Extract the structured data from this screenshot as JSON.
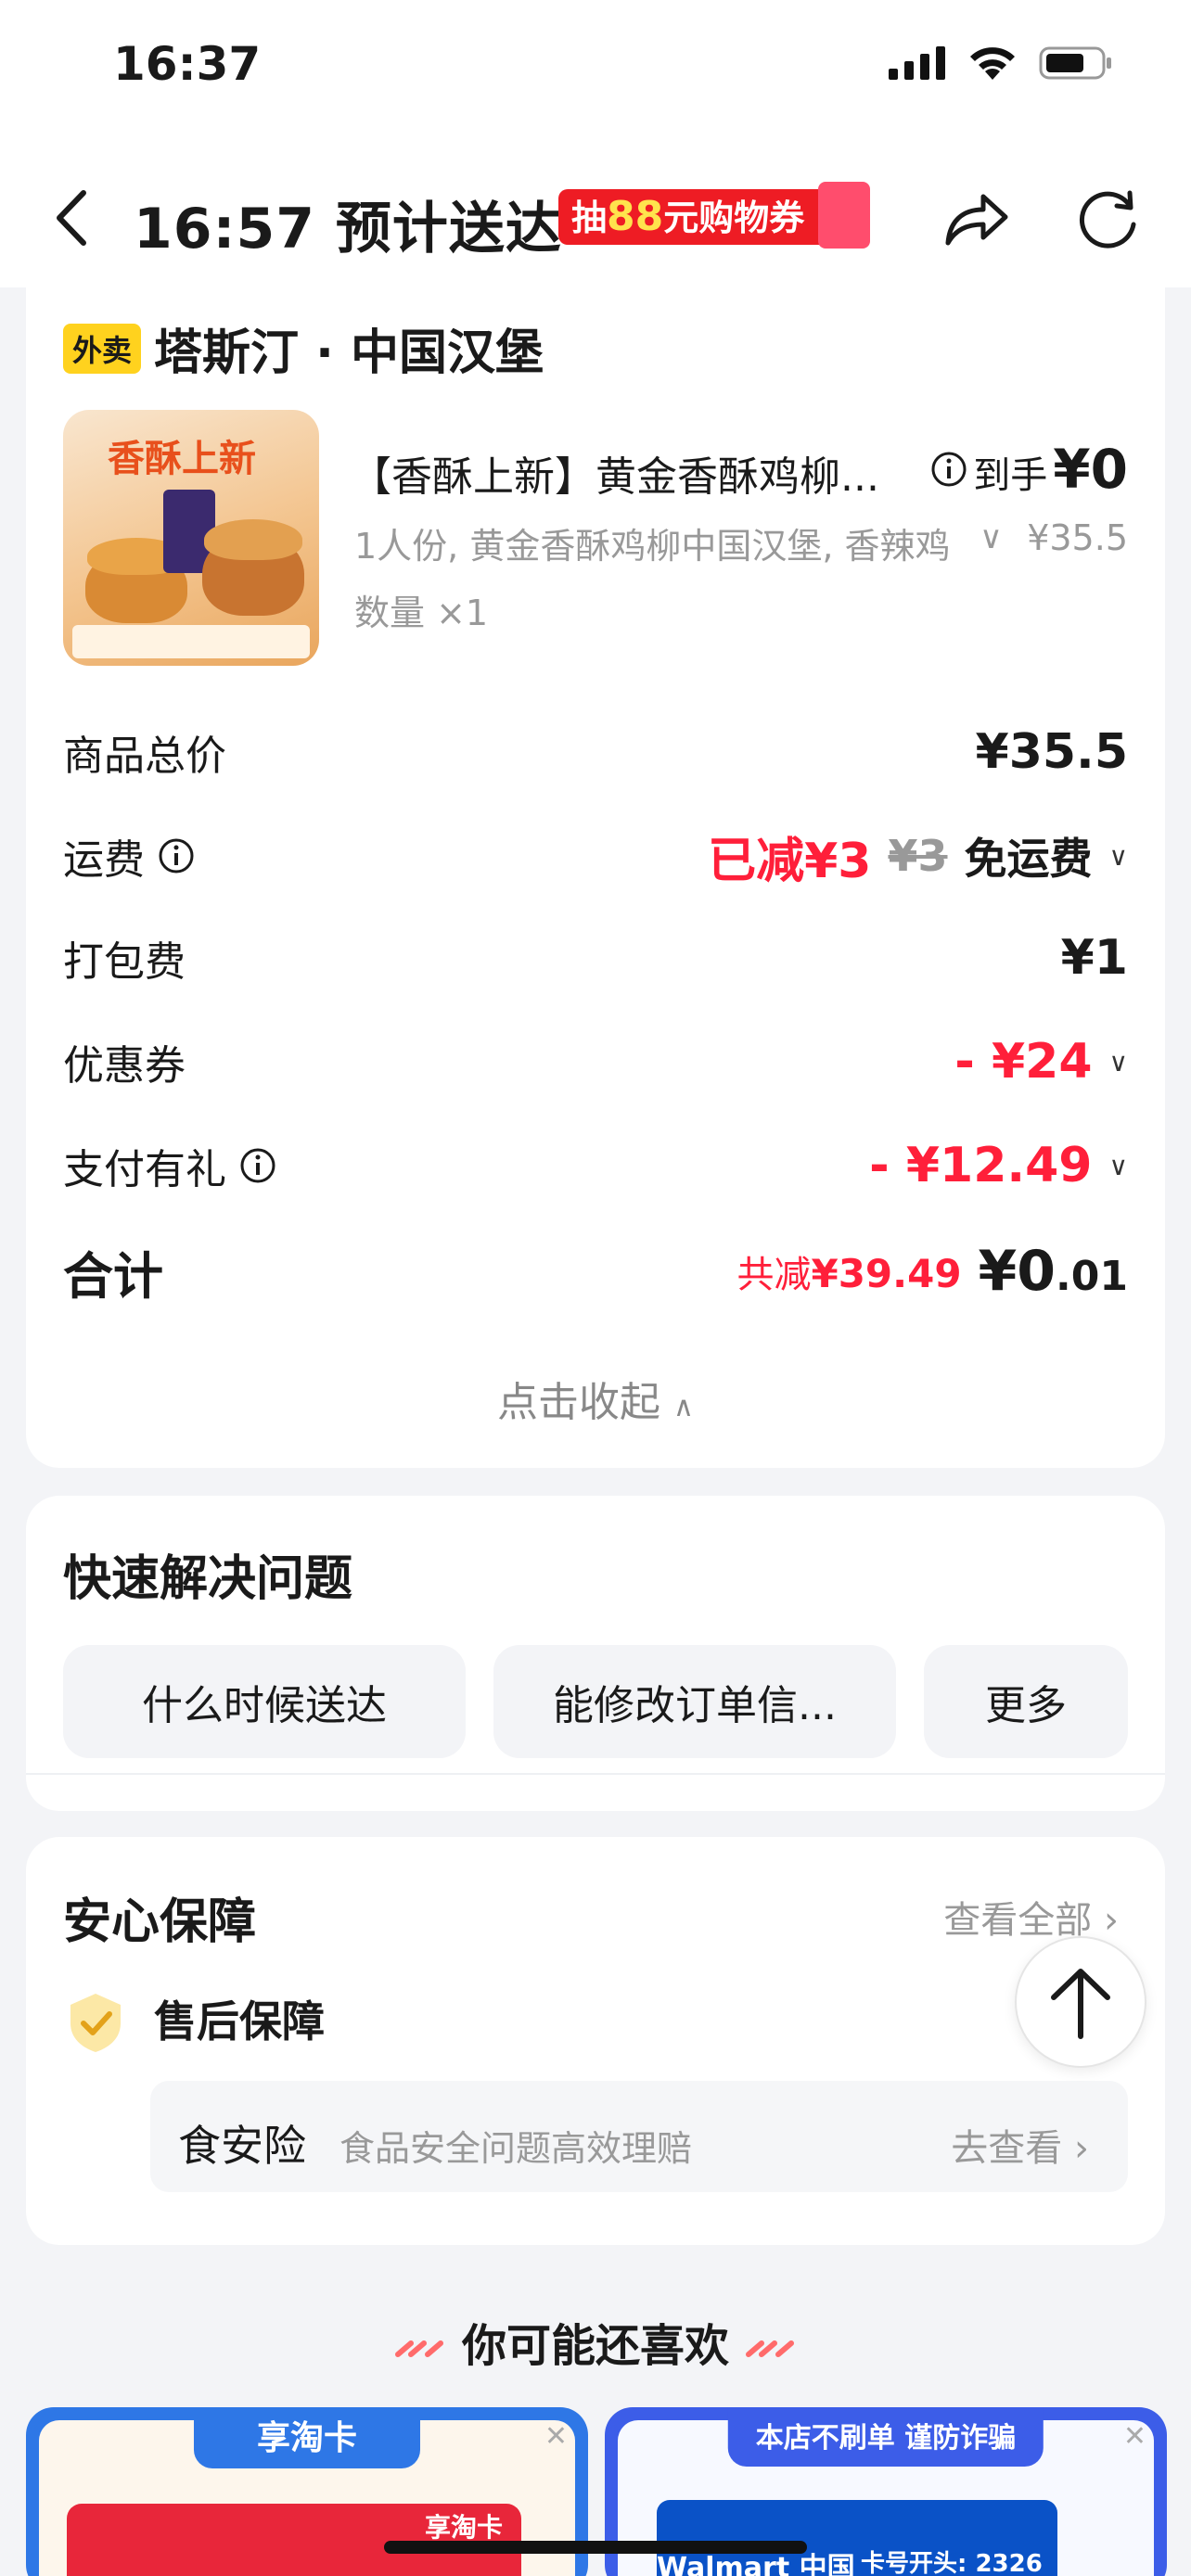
{
  "status_bar": {
    "time": "16:37"
  },
  "nav": {
    "title": "16:57 预计送达",
    "promo_prefix": "抽",
    "promo_highlight": "88",
    "promo_suffix": "元购物券"
  },
  "order": {
    "tag": "外卖",
    "store_name": "塔斯汀 · 中国汉堡",
    "product": {
      "image_title": "香酥上新",
      "name": "【香酥上新】黄金香酥鸡柳...",
      "daoshou_label": "到手",
      "daoshou_price": "¥0",
      "spec": "1人份, 黄金香酥鸡柳中国汉堡, 香辣鸡",
      "original_price": "¥35.5",
      "quantity": "数量 ×1"
    },
    "fees": {
      "goods_total_label": "商品总价",
      "goods_total_value": "¥35.5",
      "shipping_label": "运费",
      "shipping_discount": "已减¥3",
      "shipping_original": "¥3",
      "shipping_free": "免运费",
      "packing_label": "打包费",
      "packing_value": "¥1",
      "coupon_label": "优惠券",
      "coupon_value": "- ¥24",
      "pay_gift_label": "支付有礼",
      "pay_gift_value": "- ¥12.49",
      "total_label": "合计",
      "total_discount_prefix": "共减",
      "total_discount_value": "¥39.49",
      "total_main": "¥0",
      "total_cents": ".01"
    },
    "collapse_label": "点击收起"
  },
  "help": {
    "title": "快速解决问题",
    "chips": [
      "什么时候送达",
      "能修改订单信...",
      "更多"
    ]
  },
  "safety": {
    "title": "安心保障",
    "view_all": "查看全部",
    "after_sale": "售后保障",
    "food_label": "食安险",
    "food_desc": "食品安全问题高效理赔",
    "food_go": "去查看"
  },
  "recommend": {
    "title": "你可能还喜欢",
    "cards": [
      {
        "tag": "享淘卡",
        "brand": "享淘卡"
      },
      {
        "tag": "本店不刷单 谨防诈骗",
        "brand": "Walmart 中国",
        "card_no": "卡号开头: 2326"
      }
    ]
  },
  "colors": {
    "accent_red": "#ff1f3a",
    "tag_yellow": "#ffd21e",
    "blue": "#2e77e6"
  }
}
